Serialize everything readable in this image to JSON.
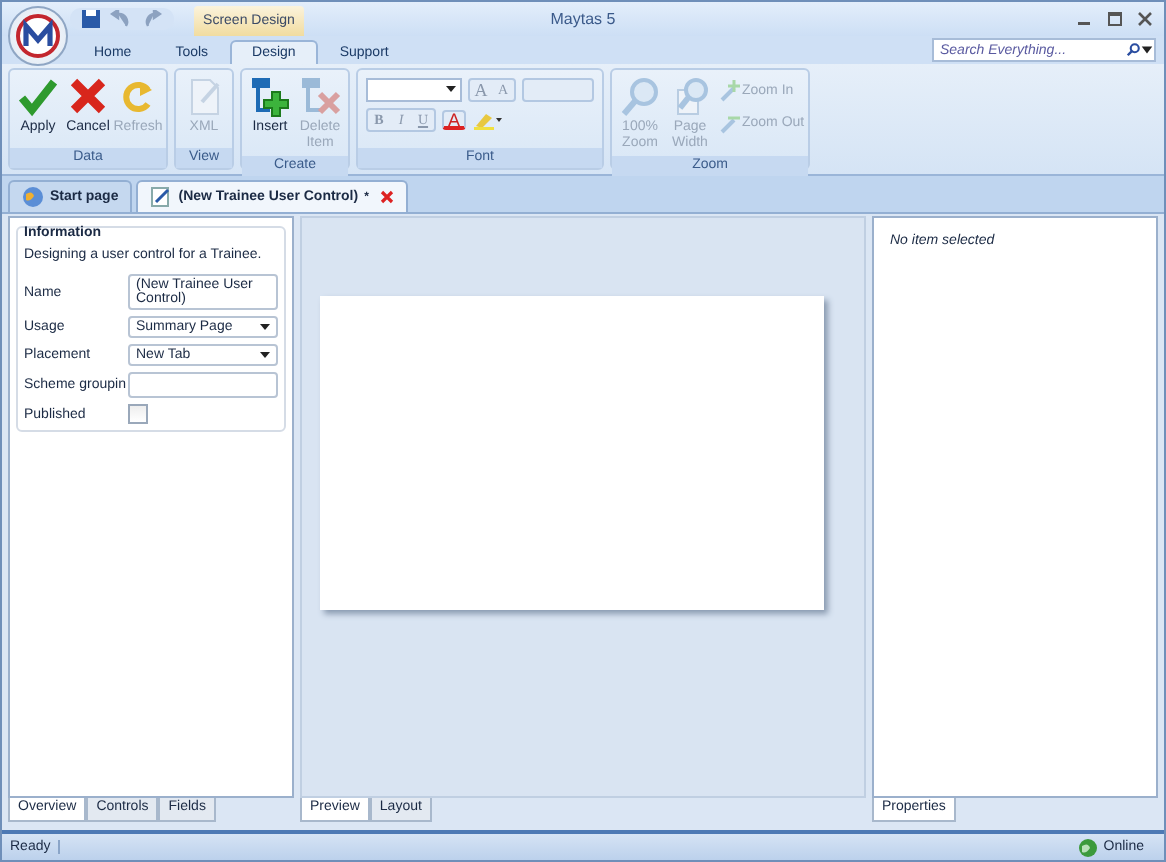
{
  "window": {
    "title": "Maytas 5"
  },
  "contextual_tab": {
    "label": "Screen Design"
  },
  "ribbon_tabs": [
    {
      "label": "Home",
      "selected": false
    },
    {
      "label": "Tools",
      "selected": false
    },
    {
      "label": "Design",
      "selected": true
    },
    {
      "label": "Support",
      "selected": false
    }
  ],
  "search": {
    "placeholder": "Search Everything..."
  },
  "ribbon_groups": [
    {
      "kind": "buttons",
      "name": "Data",
      "items": [
        {
          "kind": "large",
          "label": "Apply",
          "disabled": false
        },
        {
          "kind": "large",
          "label": "Cancel",
          "disabled": false
        },
        {
          "kind": "large",
          "label": "Refresh",
          "disabled": true
        }
      ]
    },
    {
      "kind": "buttons",
      "name": "View",
      "items": [
        {
          "kind": "large",
          "label": "XML",
          "disabled": true
        }
      ]
    },
    {
      "kind": "buttons",
      "name": "Create",
      "items": [
        {
          "kind": "large",
          "label": "Insert",
          "disabled": false
        },
        {
          "kind": "large",
          "label": "Delete Item",
          "disabled": true
        }
      ]
    },
    {
      "kind": "font",
      "name": "Font",
      "size_buttons": [
        "A",
        "A"
      ],
      "format_buttons": [
        "B",
        "I",
        "U"
      ],
      "color_button": "A"
    },
    {
      "kind": "buttons",
      "name": "Zoom",
      "items": [
        {
          "kind": "large",
          "label": "100% Zoom",
          "disabled": true
        },
        {
          "kind": "large",
          "label": "Page Width",
          "disabled": true
        },
        {
          "kind": "small",
          "label": "Zoom In",
          "disabled": true
        },
        {
          "kind": "small",
          "label": "Zoom Out",
          "disabled": true
        }
      ]
    }
  ],
  "document_tabs": [
    {
      "label": "Start page",
      "selected": false
    },
    {
      "label": "(New Trainee User Control)",
      "selected": true,
      "marker": "*"
    }
  ],
  "information": {
    "title": "Information",
    "description": "Designing a user control for a Trainee.",
    "fields": [
      {
        "kind": "text",
        "label": "Name",
        "value": "(New Trainee User Control)"
      },
      {
        "kind": "dropdown",
        "label": "Usage",
        "value": "Summary Page"
      },
      {
        "kind": "dropdown",
        "label": "Placement",
        "value": "New Tab"
      },
      {
        "kind": "text",
        "label": "Scheme groupin"
      },
      {
        "kind": "checkbox",
        "label": "Published",
        "checked": false
      }
    ]
  },
  "left_tabs": [
    {
      "label": "Overview",
      "selected": true
    },
    {
      "label": "Controls",
      "selected": false
    },
    {
      "label": "Fields",
      "selected": false
    }
  ],
  "center_tabs": [
    {
      "label": "Preview",
      "selected": true
    },
    {
      "label": "Layout",
      "selected": false
    }
  ],
  "properties": {
    "message": "No item selected"
  },
  "right_tabs": [
    {
      "label": "Properties",
      "selected": true
    }
  ],
  "status_bar": {
    "status": "Ready",
    "connection": "Online"
  }
}
